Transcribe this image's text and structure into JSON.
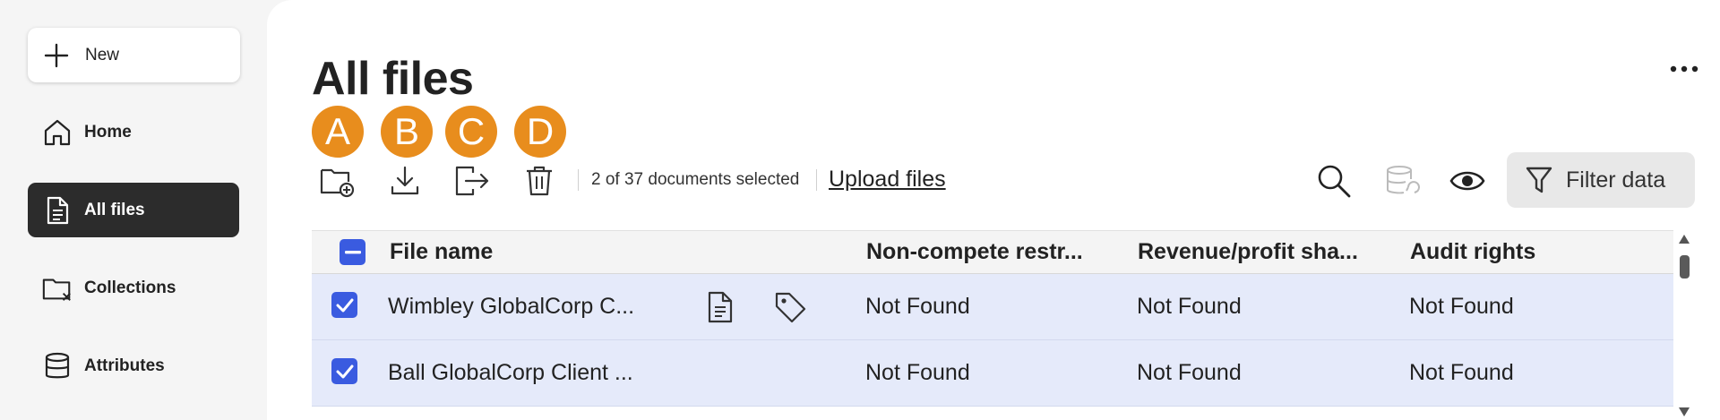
{
  "sidebar": {
    "new_label": "New",
    "items": [
      {
        "label": "Home",
        "icon": "home-icon"
      },
      {
        "label": "All files",
        "icon": "document-icon",
        "active": true
      },
      {
        "label": "Collections",
        "icon": "folder-collection-icon"
      },
      {
        "label": "Attributes",
        "icon": "database-icon"
      }
    ]
  },
  "main": {
    "title": "All files",
    "badges": [
      "A",
      "B",
      "C",
      "D"
    ],
    "selection_text": "2 of 37 documents selected",
    "upload_label": "Upload files",
    "filter_label": "Filter data"
  },
  "table": {
    "columns": [
      "File name",
      "Non-compete restr...",
      "Revenue/profit sha...",
      "Audit rights"
    ],
    "rows": [
      {
        "name": "Wimbley GlobalCorp C...",
        "non_compete": "Not Found",
        "revenue": "Not Found",
        "audit": "Not Found",
        "checked": true
      },
      {
        "name": "Ball GlobalCorp Client ...",
        "non_compete": "Not Found",
        "revenue": "Not Found",
        "audit": "Not Found",
        "checked": true
      }
    ]
  },
  "colors": {
    "accent": "#3a5be0",
    "badge": "#e88d1d",
    "active_nav": "#2c2c2c",
    "selected_row": "#e5eafa"
  }
}
